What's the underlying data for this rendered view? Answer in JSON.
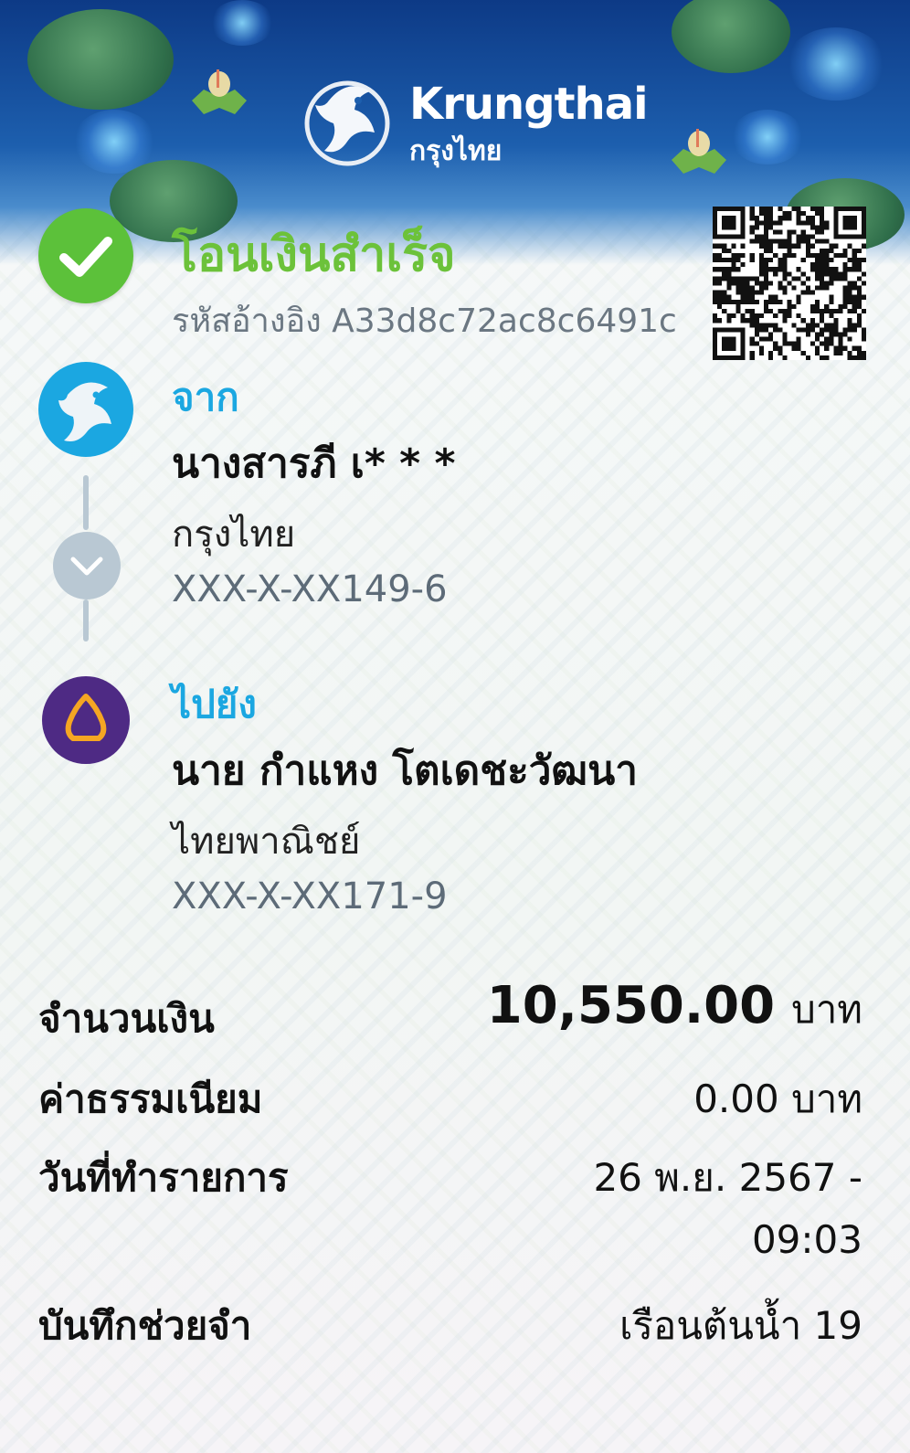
{
  "brand": {
    "name_en": "Krungthai",
    "name_th": "กรุงไทย"
  },
  "status": {
    "title": "โอนเงินสำเร็จ",
    "reference": "รหัสอ้างอิง A33d8c72ac8c6491c",
    "icon": "check-icon",
    "color": "#5cc13a"
  },
  "from": {
    "label": "จาก",
    "name": "นางสารภี เ* * *",
    "bank": "กรุงไทย",
    "account": "XXX-X-XX149-6"
  },
  "to": {
    "label": "ไปยัง",
    "name": "นาย กำแหง โตเดชะวัฒนา",
    "bank": "ไทยพาณิชย์",
    "account": "XXX-X-XX171-9"
  },
  "details": {
    "amount_label": "จำนวนเงิน",
    "amount_value": "10,550.00",
    "amount_unit": "บาท",
    "fee_label": "ค่าธรรมเนียม",
    "fee_value": "0.00 บาท",
    "date_label": "วันที่ทำรายการ",
    "date_value_line1": "26 พ.ย. 2567 -",
    "date_value_line2": "09:03",
    "memo_label": "บันทึกช่วยจำ",
    "memo_value": "เรือนต้นน้ำ 19"
  },
  "colors": {
    "accent_blue": "#1ba7e1",
    "success_green": "#6cc23a",
    "scb_purple": "#4e2a84",
    "header_blue": "#0d3a86"
  }
}
